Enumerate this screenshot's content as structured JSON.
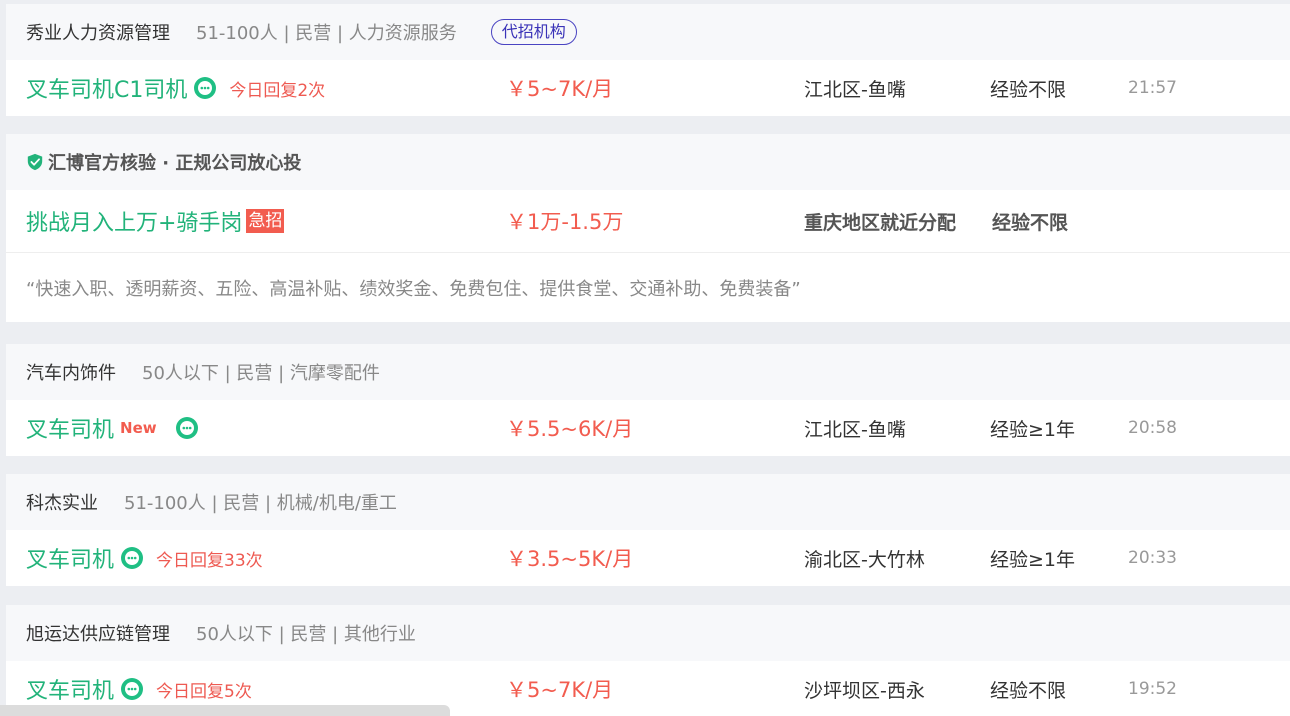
{
  "cards": [
    {
      "company": "秀业人力资源管理",
      "info": "51-100人 | 民营 | 人力资源服务",
      "badge": "代招机构",
      "job": {
        "title": "叉车司机C1司机",
        "reply": "今日回复2次",
        "salary": "￥5~7K/月",
        "location": "江北区-鱼嘴",
        "experience": "经验不限",
        "time": "21:57"
      }
    },
    {
      "verify": "汇博官方核验 · 正规公司放心投",
      "job": {
        "title": "挑战月入上万+骑手岗",
        "urgent": "急招",
        "salary": "￥1万-1.5万",
        "location": "重庆地区就近分配",
        "experience": "经验不限"
      },
      "welfare": "“快速入职、透明薪资、五险、高温补贴、绩效奖金、免费包住、提供食堂、交通补助、免费装备”"
    },
    {
      "company": "汽车内饰件",
      "info": "50人以下 | 民营 | 汽摩零配件",
      "job": {
        "title": "叉车司机",
        "new_tag": "New",
        "salary": "￥5.5~6K/月",
        "location": "江北区-鱼嘴",
        "experience": "经验≥1年",
        "time": "20:58"
      }
    },
    {
      "company": "科杰实业",
      "info": "51-100人 | 民营 | 机械/机电/重工",
      "job": {
        "title": "叉车司机",
        "reply": "今日回复33次",
        "salary": "￥3.5~5K/月",
        "location": "渝北区-大竹林",
        "experience": "经验≥1年",
        "time": "20:33"
      }
    },
    {
      "company": "旭运达供应链管理",
      "info": "50人以下 | 民营 | 其他行业",
      "job": {
        "title": "叉车司机",
        "reply": "今日回复5次",
        "salary": "￥5~7K/月",
        "location": "沙坪坝区-西永",
        "experience": "经验不限",
        "time": "19:52"
      }
    }
  ],
  "colors": {
    "title_green": "#22b37a",
    "salary_red": "#f25c4f",
    "badge_blue": "#3a33b8",
    "chat_green": "#1fbf84",
    "shield_green": "#22b37a"
  },
  "icons": {
    "chat": "chat-bubble-icon",
    "verify": "shield-check-icon"
  }
}
